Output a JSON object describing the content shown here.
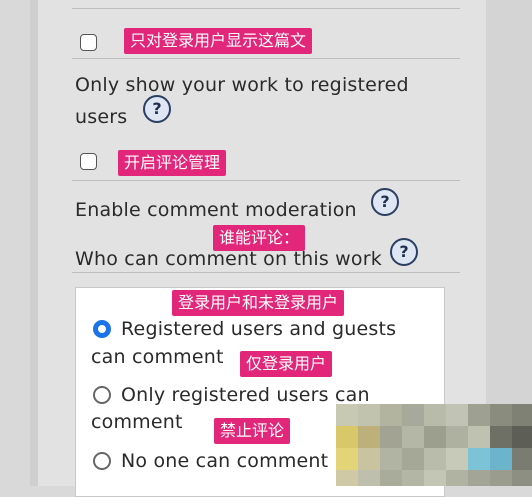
{
  "form": {
    "restricted": {
      "label_line1": "Only show your work to registered",
      "label_line2": "users",
      "help": "?",
      "annotation": "只对登录用户显示这篇文"
    },
    "moderation": {
      "label": "Enable comment moderation",
      "help": "?",
      "annotation": "开启评论管理"
    },
    "who_can_comment": {
      "label": "Who can comment on this work",
      "help": "?",
      "annotation": "谁能评论："
    },
    "options": [
      {
        "line1": "Registered users and guests",
        "line2": "can comment",
        "selected": true,
        "annotation": "登录用户和未登录用户"
      },
      {
        "line1": "Only registered users can",
        "line2": "comment",
        "selected": false,
        "annotation": "仅登录用户"
      },
      {
        "line1": "No one can comment",
        "selected": false,
        "annotation": "禁止评论"
      }
    ]
  },
  "colors": {
    "annotation_bg": "#e2277a",
    "radio_selected": "#1a73e8"
  }
}
